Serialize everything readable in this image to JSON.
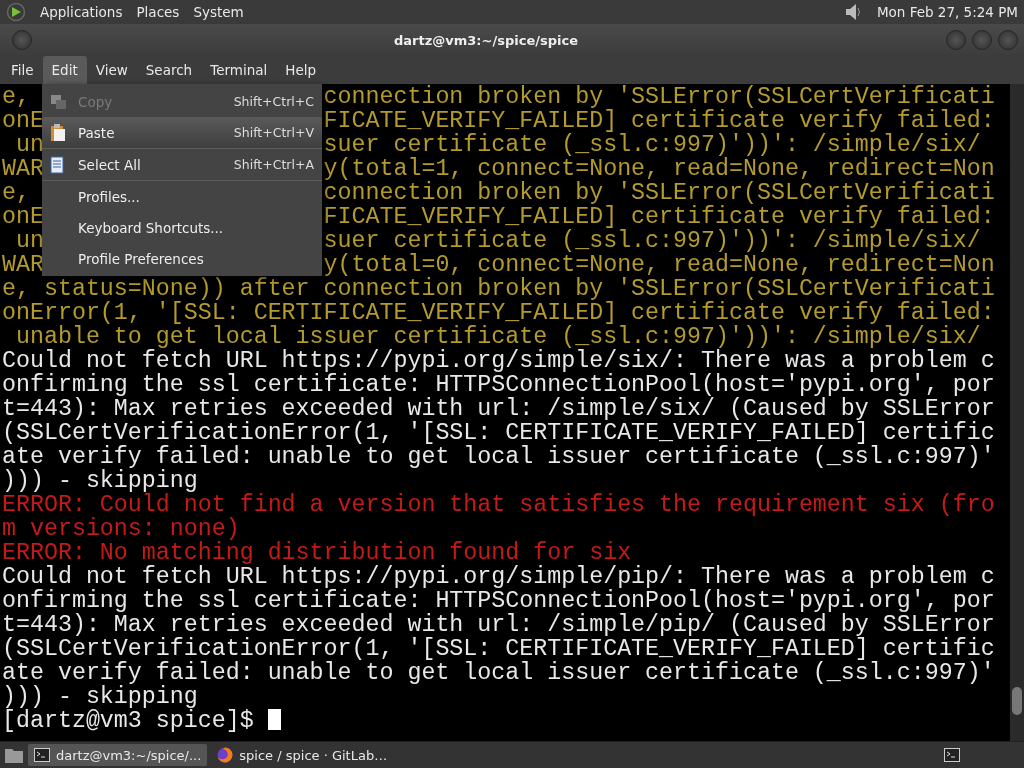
{
  "top_panel": {
    "menus": [
      "Applications",
      "Places",
      "System"
    ],
    "clock": "Mon Feb 27,  5:24 PM"
  },
  "window": {
    "title": "dartz@vm3:~/spice/spice"
  },
  "menubar": [
    {
      "label": "File",
      "selected": false
    },
    {
      "label": "Edit",
      "selected": true
    },
    {
      "label": "View",
      "selected": false
    },
    {
      "label": "Search",
      "selected": false
    },
    {
      "label": "Terminal",
      "selected": false
    },
    {
      "label": "Help",
      "selected": false
    }
  ],
  "edit_menu": [
    {
      "kind": "copy",
      "label": "Copy",
      "shortcut": "Shift+Ctrl+C",
      "disabled": true,
      "selected": false
    },
    {
      "kind": "paste",
      "label": "Paste",
      "shortcut": "Shift+Ctrl+V",
      "disabled": false,
      "selected": true
    },
    {
      "kind": "separator"
    },
    {
      "kind": "select",
      "label": "Select All",
      "shortcut": "Shift+Ctrl+A",
      "disabled": false,
      "selected": false
    },
    {
      "kind": "separator"
    },
    {
      "kind": "item",
      "label": "Profiles...",
      "disabled": false,
      "selected": false
    },
    {
      "kind": "item",
      "label": "Keyboard Shortcuts...",
      "disabled": false,
      "selected": false
    },
    {
      "kind": "item",
      "label": "Profile Preferences",
      "disabled": false,
      "selected": false
    }
  ],
  "terminal": {
    "lines": [
      {
        "kind": "warning",
        "left": "e,",
        "right": "connection broken by 'SSLError(SSLCertVerificati"
      },
      {
        "kind": "warning",
        "left": "onE",
        "right": "FICATE_VERIFY_FAILED] certificate verify failed:"
      },
      {
        "kind": "warning",
        "left": " un",
        "right": "suer certificate (_ssl.c:997)'))': /simple/six/"
      },
      {
        "kind": "warning",
        "left": "WAR",
        "right": "y(total=1, connect=None, read=None, redirect=Non"
      },
      {
        "kind": "warning",
        "left": "e,",
        "right": "connection broken by 'SSLError(SSLCertVerificati"
      },
      {
        "kind": "warning",
        "left": "onE",
        "right": "FICATE_VERIFY_FAILED] certificate verify failed:"
      },
      {
        "kind": "warning",
        "left": " un",
        "right": "suer certificate (_ssl.c:997)'))': /simple/six/"
      },
      {
        "kind": "warning",
        "left": "WAR",
        "right": "y(total=0, connect=None, read=None, redirect=Non"
      },
      {
        "kind": "warning",
        "text": "e, status=None)) after connection broken by 'SSLError(SSLCertVerificati"
      },
      {
        "kind": "warning",
        "text": "onError(1, '[SSL: CERTIFICATE_VERIFY_FAILED] certificate verify failed:"
      },
      {
        "kind": "warning",
        "text": " unable to get local issuer certificate (_ssl.c:997)'))': /simple/six/"
      },
      {
        "kind": "normal",
        "text": "Could not fetch URL https://pypi.org/simple/six/: There was a problem c"
      },
      {
        "kind": "normal",
        "text": "onfirming the ssl certificate: HTTPSConnectionPool(host='pypi.org', por"
      },
      {
        "kind": "normal",
        "text": "t=443): Max retries exceeded with url: /simple/six/ (Caused by SSLError"
      },
      {
        "kind": "normal",
        "text": "(SSLCertVerificationError(1, '[SSL: CERTIFICATE_VERIFY_FAILED] certific"
      },
      {
        "kind": "normal",
        "text": "ate verify failed: unable to get local issuer certificate (_ssl.c:997)'"
      },
      {
        "kind": "normal",
        "text": "))) - skipping"
      },
      {
        "kind": "error",
        "text": "ERROR: Could not find a version that satisfies the requirement six (fro"
      },
      {
        "kind": "error",
        "text": "m versions: none)"
      },
      {
        "kind": "error",
        "text": "ERROR: No matching distribution found for six"
      },
      {
        "kind": "normal",
        "text": "Could not fetch URL https://pypi.org/simple/pip/: There was a problem c"
      },
      {
        "kind": "normal",
        "text": "onfirming the ssl certificate: HTTPSConnectionPool(host='pypi.org', por"
      },
      {
        "kind": "normal",
        "text": "t=443): Max retries exceeded with url: /simple/pip/ (Caused by SSLError"
      },
      {
        "kind": "normal",
        "text": "(SSLCertVerificationError(1, '[SSL: CERTIFICATE_VERIFY_FAILED] certific"
      },
      {
        "kind": "normal",
        "text": "ate verify failed: unable to get local issuer certificate (_ssl.c:997)'"
      },
      {
        "kind": "normal",
        "text": "))) - skipping"
      },
      {
        "kind": "prompt",
        "text": "[dartz@vm3 spice]$ "
      }
    ]
  },
  "taskbar": {
    "tasks": [
      {
        "label": "dartz@vm3:~/spice/...",
        "kind": "terminal",
        "selected": true
      },
      {
        "label": "spice / spice · GitLab…",
        "kind": "browser",
        "selected": false
      }
    ]
  }
}
